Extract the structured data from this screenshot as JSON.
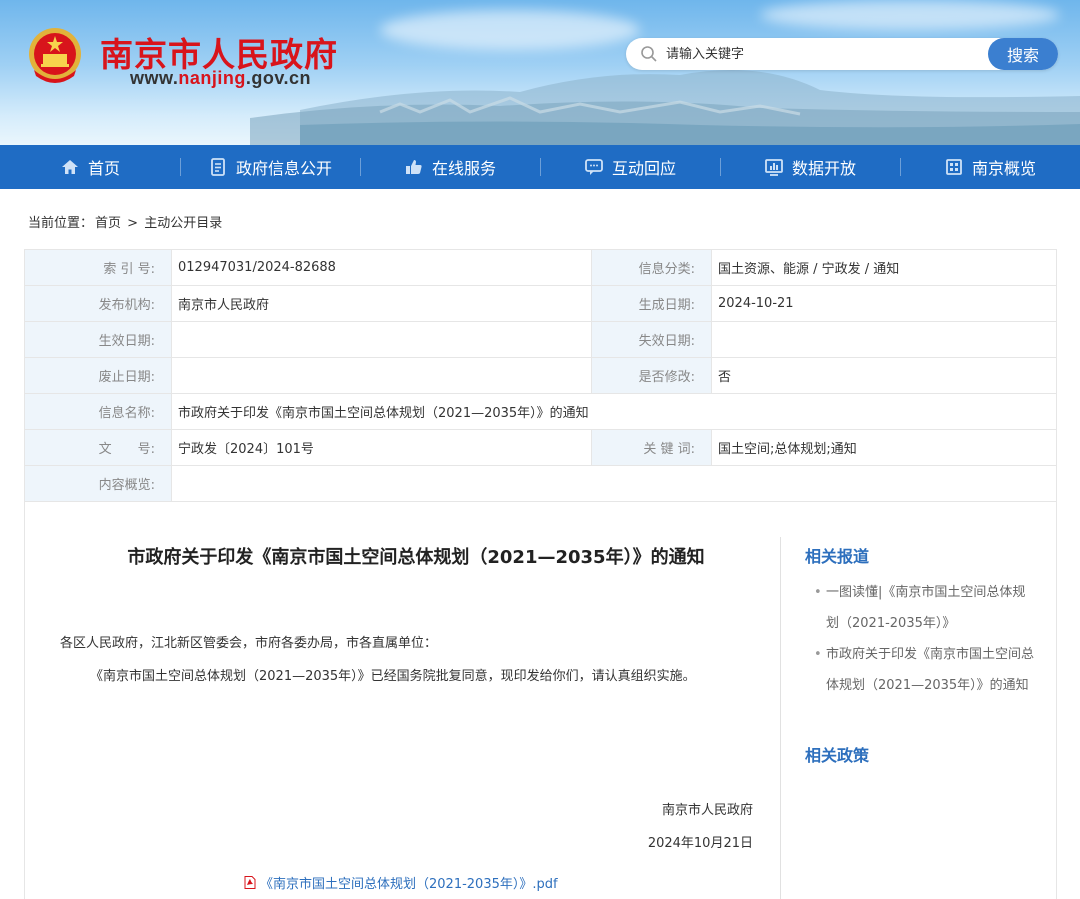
{
  "header": {
    "site_name": "南京市人民政府",
    "site_url_pre": "www.",
    "site_url_brand": "nanjing",
    "site_url_post": ".gov.cn",
    "search_placeholder": "请输入关键字",
    "search_button": "搜索"
  },
  "nav": [
    {
      "label": "首页",
      "icon": "home-icon"
    },
    {
      "label": "政府信息公开",
      "icon": "document-icon"
    },
    {
      "label": "在线服务",
      "icon": "thumbs-up-icon"
    },
    {
      "label": "互动回应",
      "icon": "chat-icon"
    },
    {
      "label": "数据开放",
      "icon": "chart-icon"
    },
    {
      "label": "南京概览",
      "icon": "building-icon"
    }
  ],
  "breadcrumb": {
    "prefix": "当前位置：",
    "home": "首页",
    "sep": ">",
    "current": "主动公开目录"
  },
  "info": {
    "index_label": "索 引 号:",
    "index_value": "012947031/2024-82688",
    "category_label": "信息分类:",
    "category_value": "国土资源、能源 / 宁政发 / 通知",
    "publisher_label": "发布机构:",
    "publisher_value": "南京市人民政府",
    "created_label": "生成日期:",
    "created_value": "2024-10-21",
    "effective_label": "生效日期:",
    "effective_value": "",
    "invalid_label": "失效日期:",
    "invalid_value": "",
    "repeal_label": "废止日期:",
    "repeal_value": "",
    "modified_label": "是否修改:",
    "modified_value": "否",
    "name_label": "信息名称:",
    "name_value": "市政府关于印发《南京市国土空间总体规划（2021—2035年）》的通知",
    "docno_label": "文　　号:",
    "docno_value": "宁政发〔2024〕101号",
    "keywords_label": "关 键 词:",
    "keywords_value": "国土空间;总体规划;通知",
    "summary_label": "内容概览:",
    "summary_value": ""
  },
  "article": {
    "title": "市政府关于印发《南京市国土空间总体规划（2021—2035年）》的通知",
    "recipients": "各区人民政府，江北新区管委会，市府各委办局，市各直属单位：",
    "body": "《南京市国土空间总体规划（2021—2035年）》已经国务院批复同意，现印发给你们，请认真组织实施。",
    "sign_org": "南京市人民政府",
    "sign_date": "2024年10月21日",
    "attachment": "《南京市国土空间总体规划（2021-2035年）》.pdf"
  },
  "sidebar": {
    "related_reports_title": "相关报道",
    "related_reports": [
      "一图读懂|《南京市国土空间总体规划（2021-2035年）》",
      "市政府关于印发《南京市国土空间总体规划（2021—2035年）》的通知"
    ],
    "related_policies_title": "相关政策"
  },
  "colors": {
    "brand_red": "#d8141b",
    "nav_blue": "#1f6cc4",
    "link_blue": "#2d6fbd",
    "label_bg": "#eef5fb"
  }
}
